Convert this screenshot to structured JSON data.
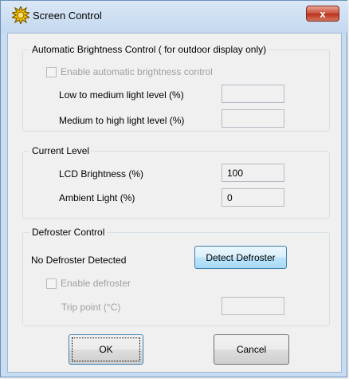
{
  "window": {
    "title": "Screen Control",
    "close_glyph": "x",
    "icon": "sun-icon"
  },
  "auto_brightness": {
    "legend": "Automatic Brightness Control ( for outdoor display only)",
    "checkbox_label": "Enable automatic brightness control",
    "checked": false,
    "low_to_medium_label": "Low to medium light level (%)",
    "low_to_medium_value": "",
    "medium_to_high_label": "Medium to high light level (%)",
    "medium_to_high_value": ""
  },
  "current_level": {
    "legend": "Current Level",
    "lcd_label": "LCD Brightness (%)",
    "lcd_value": "100",
    "ambient_label": "Ambient Light (%)",
    "ambient_value": "0"
  },
  "defroster": {
    "legend": "Defroster Control",
    "status": "No Defroster Detected",
    "detect_button": "Detect Defroster",
    "enable_label": "Enable defroster",
    "enable_checked": false,
    "trip_label": "Trip point (°C)",
    "trip_value": ""
  },
  "buttons": {
    "ok": "OK",
    "cancel": "Cancel"
  }
}
